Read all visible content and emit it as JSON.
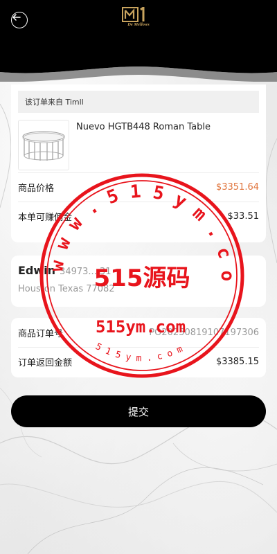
{
  "header": {
    "logo_text": "De Mellows"
  },
  "order": {
    "source_label": "该订单来自 Timll",
    "product_name": "Nuevo HGTB448 Roman Table",
    "price_label": "商品价格",
    "price_value": "$3351.64",
    "commission_label": "本单可赚佣金",
    "commission_value": "$33.51"
  },
  "address": {
    "name": "Edwin",
    "phone": "34973....31",
    "location": "Houston Texas 77082"
  },
  "summary": {
    "order_no_label": "商品订单号",
    "order_no_value": "PO20250819107197306",
    "return_label": "订单返回金额",
    "return_value": "$3385.15"
  },
  "actions": {
    "submit_label": "提交"
  },
  "watermark": {
    "ring_text": "w w w . 5 1 5 y m . c o m",
    "center_text": "515源码",
    "domain_text": "515ym.com",
    "small_text": "5 1 5 y m . c o m"
  },
  "colors": {
    "accent_price": "#e0733a",
    "brand_gold": "#c9a45e",
    "stamp_red": "#e8141c"
  }
}
